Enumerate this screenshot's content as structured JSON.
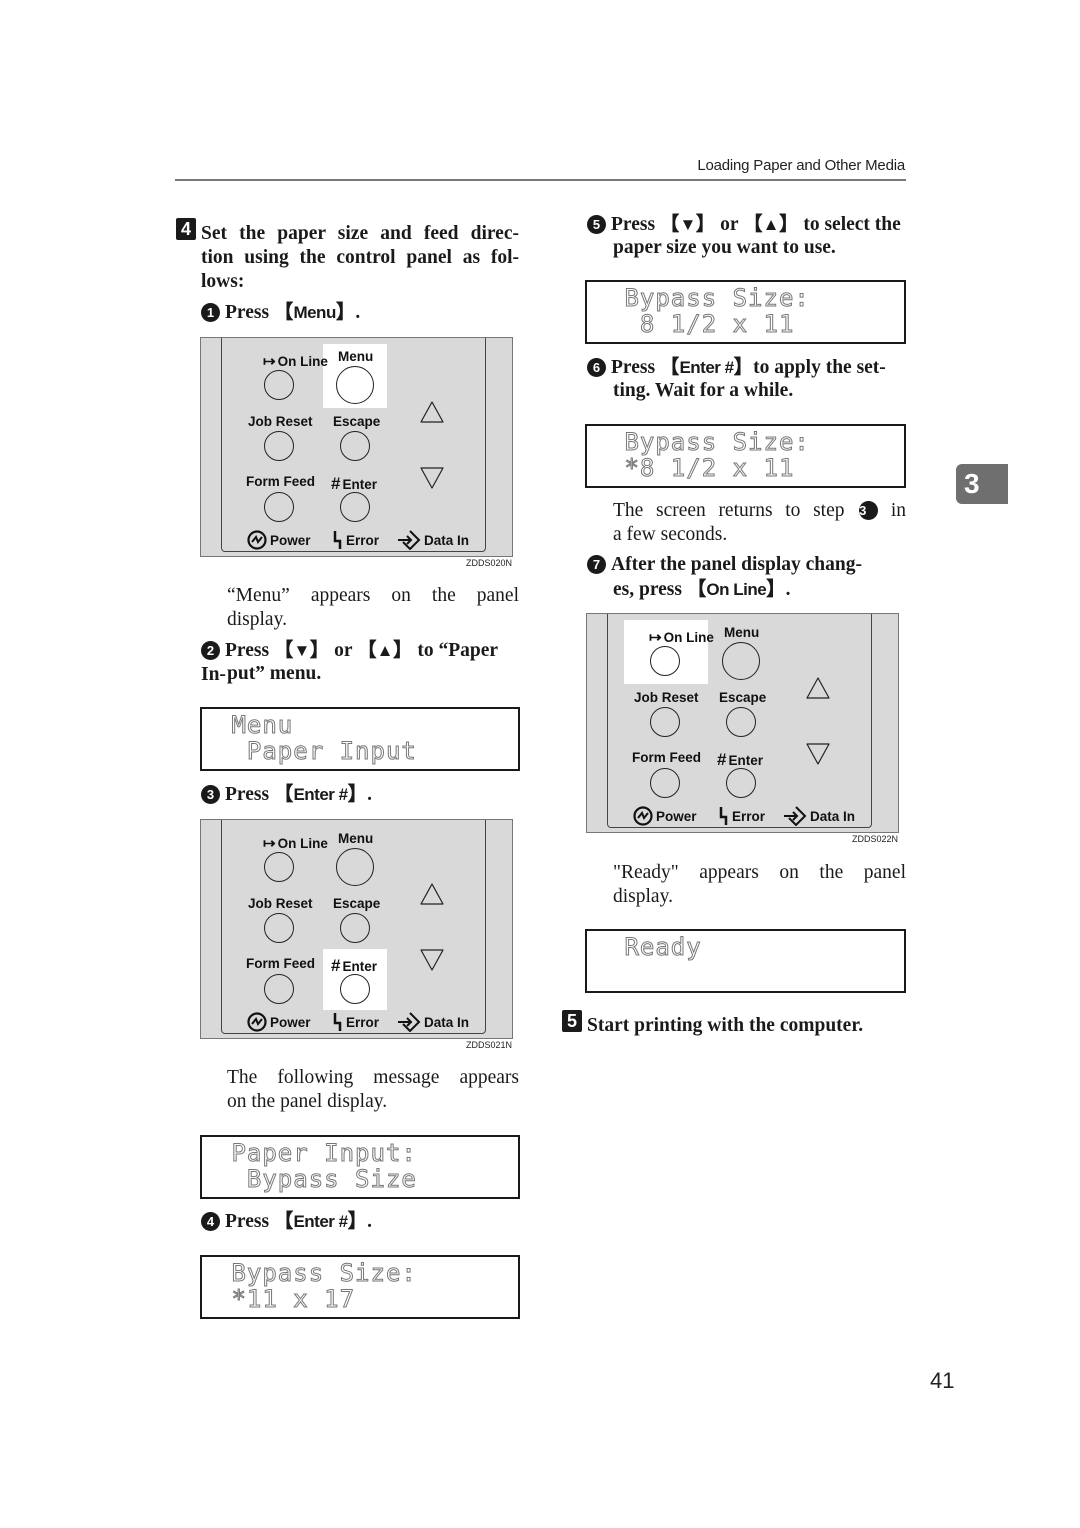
{
  "header": {
    "title": "Loading Paper and Other Media"
  },
  "chapter_tab": "3",
  "page_number": "41",
  "steps": {
    "step4": {
      "number": "4",
      "line1": "Set the paper size and feed direc-",
      "line2": "tion using the control panel as fol-",
      "line3": "lows:"
    },
    "step5": {
      "number": "5",
      "text": "Start printing with the computer."
    }
  },
  "substeps": {
    "s1": {
      "num": "1",
      "press": "Press",
      "key": "Menu",
      "after": "."
    },
    "s1_note": {
      "line1": "“Menu” appears on the panel",
      "line2": "display."
    },
    "s2": {
      "num": "2",
      "press": "Press",
      "key1": "▼",
      "or": "or",
      "key2": "▲",
      "line1_end": "to “Paper In-",
      "line2": "put” menu."
    },
    "s3": {
      "num": "3",
      "press": "Press",
      "key": "Enter #",
      "after": "."
    },
    "s3_note": {
      "line1": "The following message appears",
      "line2": "on the panel display."
    },
    "s4": {
      "num": "4",
      "press": "Press",
      "key": "Enter #",
      "after": "."
    },
    "s5": {
      "num": "5",
      "press": "Press",
      "key1": "▼",
      "or": "or",
      "key2": "▲",
      "line1_end": "to select the",
      "line2": "paper size you want to use."
    },
    "s6": {
      "num": "6",
      "press": "Press",
      "key": "Enter #",
      "line1_end": "to apply the set-",
      "line2": "ting. Wait for a while."
    },
    "s6_note": {
      "line1_a": "The screen returns to step",
      "ref": "3",
      "line1_b": "in",
      "line2": "a few seconds."
    },
    "s7": {
      "num": "7",
      "line1": "After the panel display chang-",
      "line2_a": "es, press",
      "key": "On Line",
      "after": "."
    },
    "s7_note": {
      "line1": "\"Ready\" appears on the panel",
      "line2": "display."
    }
  },
  "lcd_displays": {
    "menu": {
      "line1": " Menu",
      "line2": "  Paper Input"
    },
    "paper_input": {
      "line1": " Paper Input:",
      "line2": "  Bypass Size"
    },
    "bypass_11x17": {
      "line1": " Bypass Size:",
      "line2": " *11 x 17"
    },
    "bypass_85x11": {
      "line1": " Bypass Size:",
      "line2": "  8 1/2 x 11"
    },
    "bypass_85x11_set": {
      "line1": " Bypass Size:",
      "line2": " *8 1/2 x 11"
    },
    "ready": {
      "line1": " Ready",
      "line2": ""
    }
  },
  "panel": {
    "labels": {
      "online": "On Line",
      "menu": "Menu",
      "job_reset": "Job Reset",
      "escape": "Escape",
      "form_feed": "Form Feed",
      "enter": "Enter",
      "power": "Power",
      "error": "Error",
      "data_in": "Data In"
    },
    "figures": [
      {
        "code": "ZDDS020N",
        "highlighted": "Menu"
      },
      {
        "code": "ZDDS021N",
        "highlighted": "Enter"
      },
      {
        "code": "ZDDS022N",
        "highlighted": "On Line"
      }
    ]
  }
}
